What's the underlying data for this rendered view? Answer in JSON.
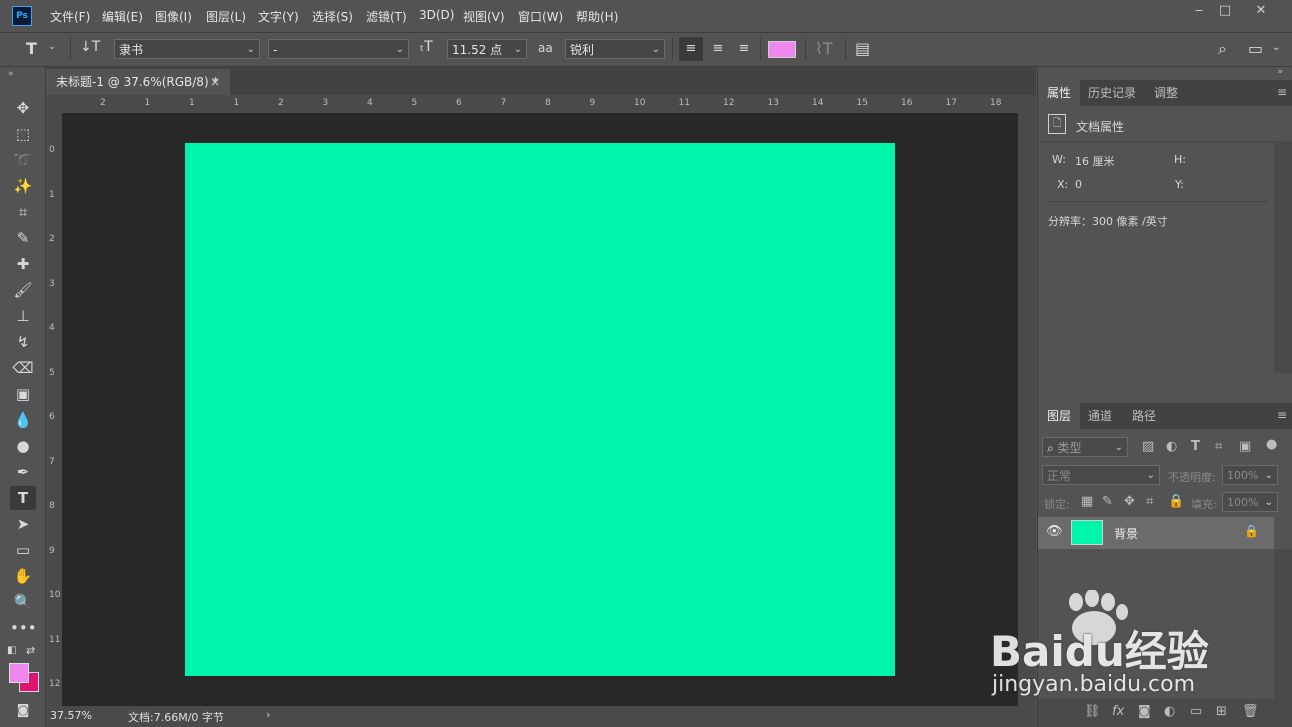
{
  "menubar": {
    "items": [
      "文件(F)",
      "编辑(E)",
      "图像(I)",
      "图层(L)",
      "文字(Y)",
      "选择(S)",
      "滤镜(T)",
      "3D(D)",
      "视图(V)",
      "窗口(W)",
      "帮助(H)"
    ],
    "logo_text": "Ps"
  },
  "options": {
    "font_family": "隶书",
    "font_style": "-",
    "font_size": "11.52 点",
    "aa_label": "aa",
    "aa_mode": "锐利",
    "text_color": "#ee88ee"
  },
  "document": {
    "tab_title": "未标题-1 @ 37.6%(RGB/8) *",
    "tab_close": "×",
    "canvas_color": "#00f5ac",
    "ruler_h": [
      "2",
      "1",
      "1",
      "1",
      "2",
      "3",
      "4",
      "5",
      "6",
      "7",
      "8",
      "9",
      "10",
      "11",
      "12",
      "13",
      "14",
      "15",
      "16",
      "17",
      "18"
    ],
    "ruler_v": [
      "0",
      "1",
      "2",
      "3",
      "4",
      "5",
      "6",
      "7",
      "8",
      "9",
      "10",
      "11",
      "12"
    ]
  },
  "status": {
    "zoom": "37.57%",
    "doc_info": "文档:7.66M/0 字节"
  },
  "properties_panel": {
    "tabs": [
      "属性",
      "历史记录",
      "调整"
    ],
    "section_title": "文档属性",
    "w_label": "W:",
    "w_value": "16 厘米",
    "h_label": "H:",
    "x_label": "X:",
    "x_value": "0",
    "y_label": "Y:",
    "resolution": "分辨率：300 像素 /英寸"
  },
  "layers_panel": {
    "tabs": [
      "图层",
      "通道",
      "路径"
    ],
    "filter_label": "类型",
    "blend_mode": "正常",
    "opacity_label": "不透明度:",
    "opacity_value": "100%",
    "lock_label": "锁定:",
    "fill_label": "填充:",
    "fill_value": "100%",
    "layer_name": "背景"
  },
  "colors": {
    "foreground": "#ee88ee",
    "background": "#e0146e"
  },
  "watermark": {
    "brand": "Baidu经验",
    "url": "jingyan.baidu.com"
  }
}
